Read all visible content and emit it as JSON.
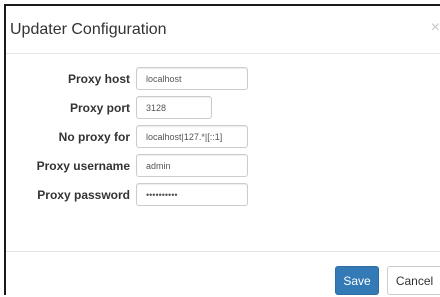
{
  "dialog": {
    "title": "Updater Configuration",
    "close_glyph": "×"
  },
  "form": {
    "proxy_host": {
      "label": "Proxy host",
      "value": "localhost"
    },
    "proxy_port": {
      "label": "Proxy port",
      "value": "3128"
    },
    "no_proxy_for": {
      "label": "No proxy for",
      "value": "localhost|127.*|[::1]"
    },
    "proxy_username": {
      "label": "Proxy username",
      "value": "admin"
    },
    "proxy_password": {
      "label": "Proxy password",
      "value": "••••••••••"
    }
  },
  "footer": {
    "save_label": "Save",
    "cancel_label": "Cancel"
  },
  "colors": {
    "primary": "#337ab7",
    "text": "#333333",
    "border": "#cccccc"
  },
  "icons": {
    "close": "close-icon"
  }
}
